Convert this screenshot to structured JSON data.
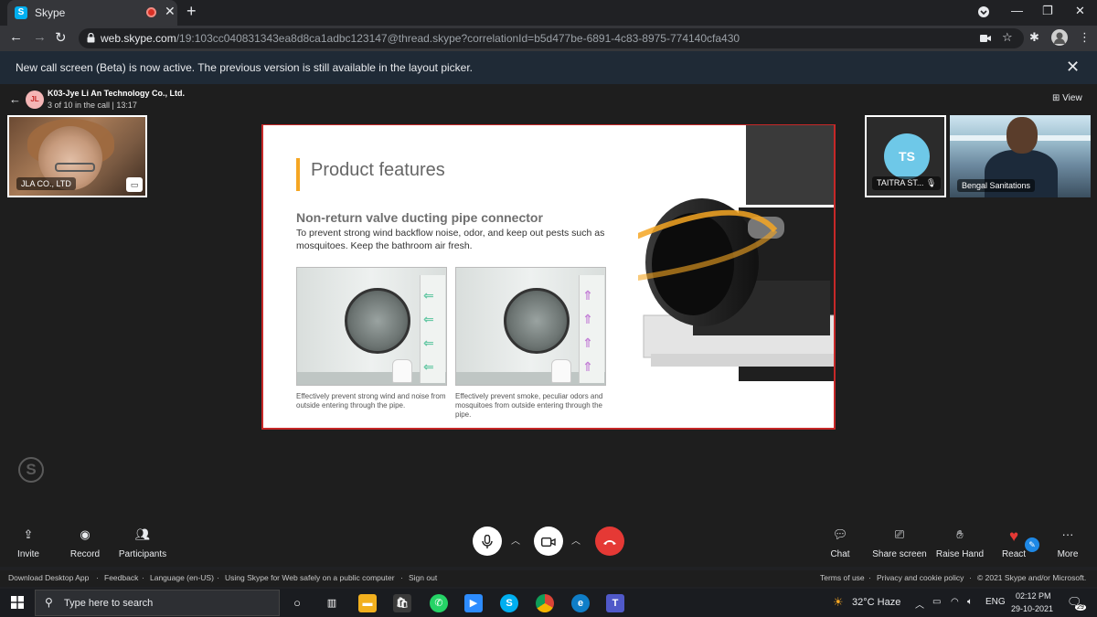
{
  "browser": {
    "tab_title": "Skype",
    "url_domain": "web.skype.com",
    "url_path": "/19:103cc040831343ea8d8ca1adbc123147@thread.skype?correlationId=b5d477be-6891-4c83-8975-774140cfa430"
  },
  "banner": {
    "message": "New call screen (Beta) is now active. The previous version is still available in the layout picker."
  },
  "call": {
    "title": "K03-Jye Li An Technology Co., Ltd.",
    "subtitle": "3 of 10 in the call | 13:17",
    "view_label": "View",
    "avatar_initials": "JL"
  },
  "participants": [
    {
      "name": "JLA CO., LTD"
    },
    {
      "name": "TAITRA ST...",
      "initials": "TS"
    },
    {
      "name": "Bengal Sanitations"
    }
  ],
  "slide": {
    "title": "Product features",
    "subtitle": "Non-return valve ducting pipe connector",
    "description": "To prevent strong wind backflow noise, odor, and keep out pests such as mosquitoes. Keep the bathroom air fresh.",
    "caption_left": "Effectively prevent strong wind and noise from outside entering through the pipe.",
    "caption_right": "Effectively prevent smoke, peculiar odors and mosquitoes from outside entering through the pipe."
  },
  "controls": {
    "invite": "Invite",
    "record": "Record",
    "participants": "Participants",
    "chat": "Chat",
    "share_screen": "Share screen",
    "raise_hand": "Raise Hand",
    "react": "React",
    "more": "More"
  },
  "footer": {
    "download": "Download Desktop App",
    "feedback": "Feedback",
    "language": "Language (en-US)",
    "safety": "Using Skype for Web safely on a public computer",
    "signout": "Sign out",
    "terms": "Terms of use",
    "privacy": "Privacy and cookie policy",
    "copyright": "© 2021 Skype and/or Microsoft."
  },
  "taskbar": {
    "search_placeholder": "Type here to search",
    "weather": "32°C Haze",
    "language": "ENG",
    "time": "02:12 PM",
    "date": "29-10-2021",
    "notifications": "29"
  },
  "colors": {
    "accent_orange": "#f5a623",
    "end_call_red": "#e53935",
    "skype_blue": "#00aff0"
  }
}
